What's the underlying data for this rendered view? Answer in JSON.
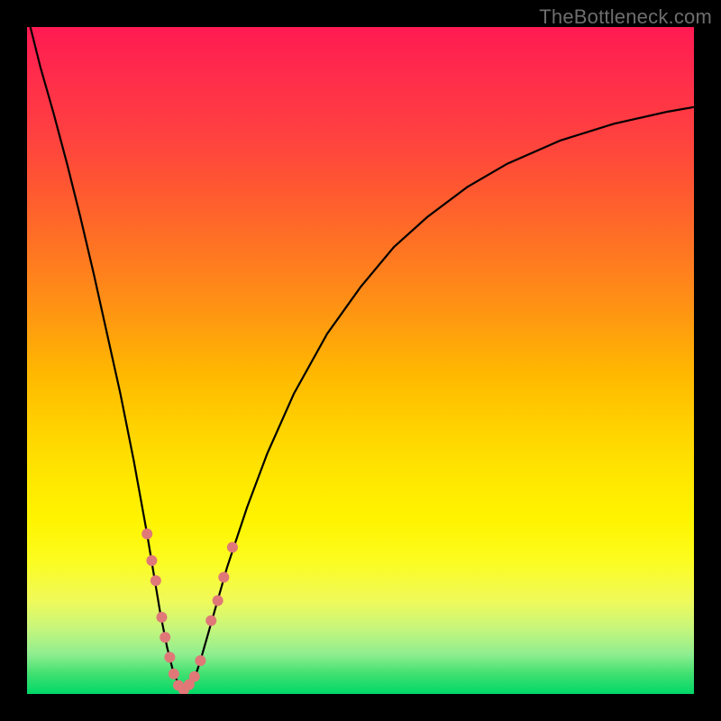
{
  "watermark": "TheBottleneck.com",
  "colors": {
    "frame": "#000000",
    "curve": "#000000",
    "markers": "#e07878",
    "gradient_top": "#ff1a52",
    "gradient_bottom": "#00d868"
  },
  "chart_data": {
    "type": "line",
    "title": "",
    "xlabel": "",
    "ylabel": "",
    "xlim": [
      0,
      100
    ],
    "ylim": [
      0,
      100
    ],
    "series": [
      {
        "name": "bottleneck-curve",
        "x": [
          0.5,
          2,
          4,
          6,
          8,
          10,
          12,
          14,
          16,
          17,
          18,
          19,
          20,
          21,
          22,
          23,
          24,
          25,
          26,
          28,
          30,
          33,
          36,
          40,
          45,
          50,
          55,
          60,
          66,
          72,
          80,
          88,
          96,
          100
        ],
        "y": [
          100,
          94,
          87,
          79.5,
          71.5,
          63,
          54,
          45,
          35,
          29.5,
          24,
          18,
          12,
          7,
          3,
          1,
          0.5,
          2,
          5,
          12,
          19,
          28,
          36,
          45,
          54,
          61,
          67,
          71.5,
          76,
          79.5,
          83,
          85.5,
          87.3,
          88
        ]
      }
    ],
    "markers": {
      "name": "highlight-points",
      "x": [
        18.0,
        18.7,
        19.3,
        20.2,
        20.7,
        21.4,
        22.0,
        22.7,
        23.5,
        24.3,
        25.1,
        26.0,
        27.6,
        28.6,
        29.5,
        30.8
      ],
      "y": [
        24.0,
        20.0,
        17.0,
        11.5,
        8.5,
        5.5,
        3.0,
        1.3,
        0.6,
        1.4,
        2.6,
        5.0,
        11.0,
        14.0,
        17.5,
        22.0
      ],
      "r": 6
    }
  }
}
